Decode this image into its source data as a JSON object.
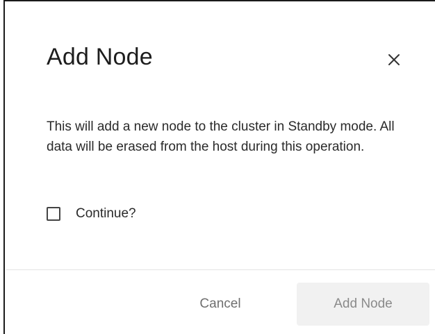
{
  "dialog": {
    "title": "Add Node",
    "close_icon": "close-icon",
    "message": "This will add a new node to the cluster in Standby mode. All data will be erased from the host during this operation.",
    "confirm_checkbox": {
      "label": "Continue?",
      "checked": false
    },
    "footer": {
      "cancel_label": "Cancel",
      "submit_label": "Add Node",
      "submit_disabled": true
    }
  },
  "colors": {
    "title_text": "#1d1d1d",
    "body_text": "#2a2a2a",
    "cancel_text": "#6f6f6f",
    "disabled_button_bg": "#f1f1f1",
    "disabled_button_text": "#8a8a8a",
    "divider": "#e4e4e4"
  }
}
